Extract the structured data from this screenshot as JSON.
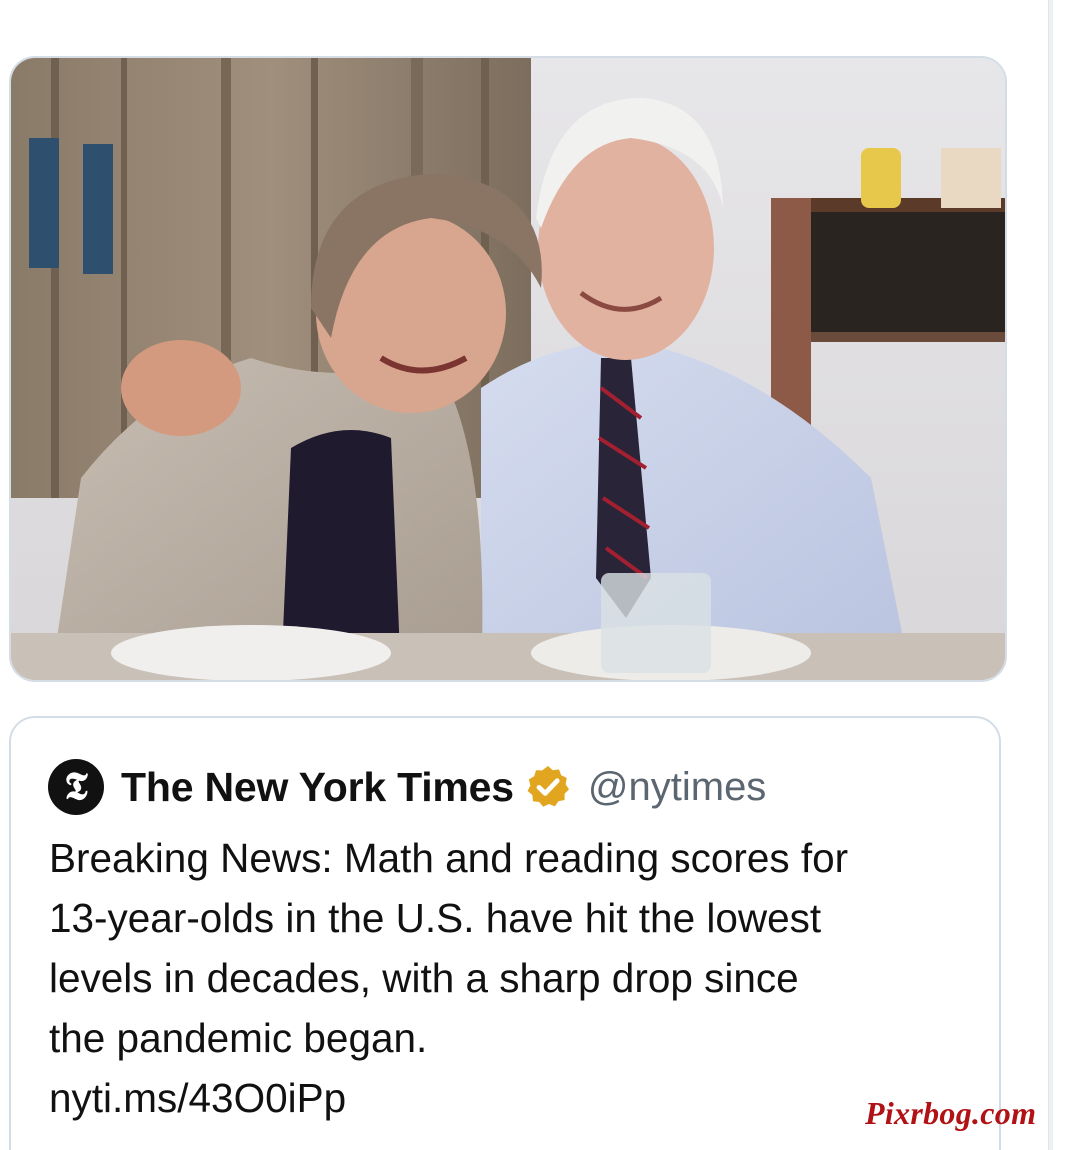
{
  "tweet": {
    "image": {
      "description_icon": "photo"
    },
    "quoted": {
      "avatar_glyph": "𝕿",
      "display_name": "The New York Times",
      "verified_icon": "verified-badge-icon",
      "handle": "@nytimes",
      "text": "Breaking News: Math and reading scores for\n13-year-olds in the U.S. have hit the lowest\nlevels in decades, with a sharp drop since\nthe pandemic began.",
      "link": "nyti.ms/43O0iPp"
    }
  },
  "watermark": {
    "text": "Pixrbog.com"
  },
  "colors": {
    "card_border": "#d4dde6",
    "handle_gray": "#5b6670",
    "verified_gold": "#e2a51f",
    "watermark_red": "#b11216"
  }
}
